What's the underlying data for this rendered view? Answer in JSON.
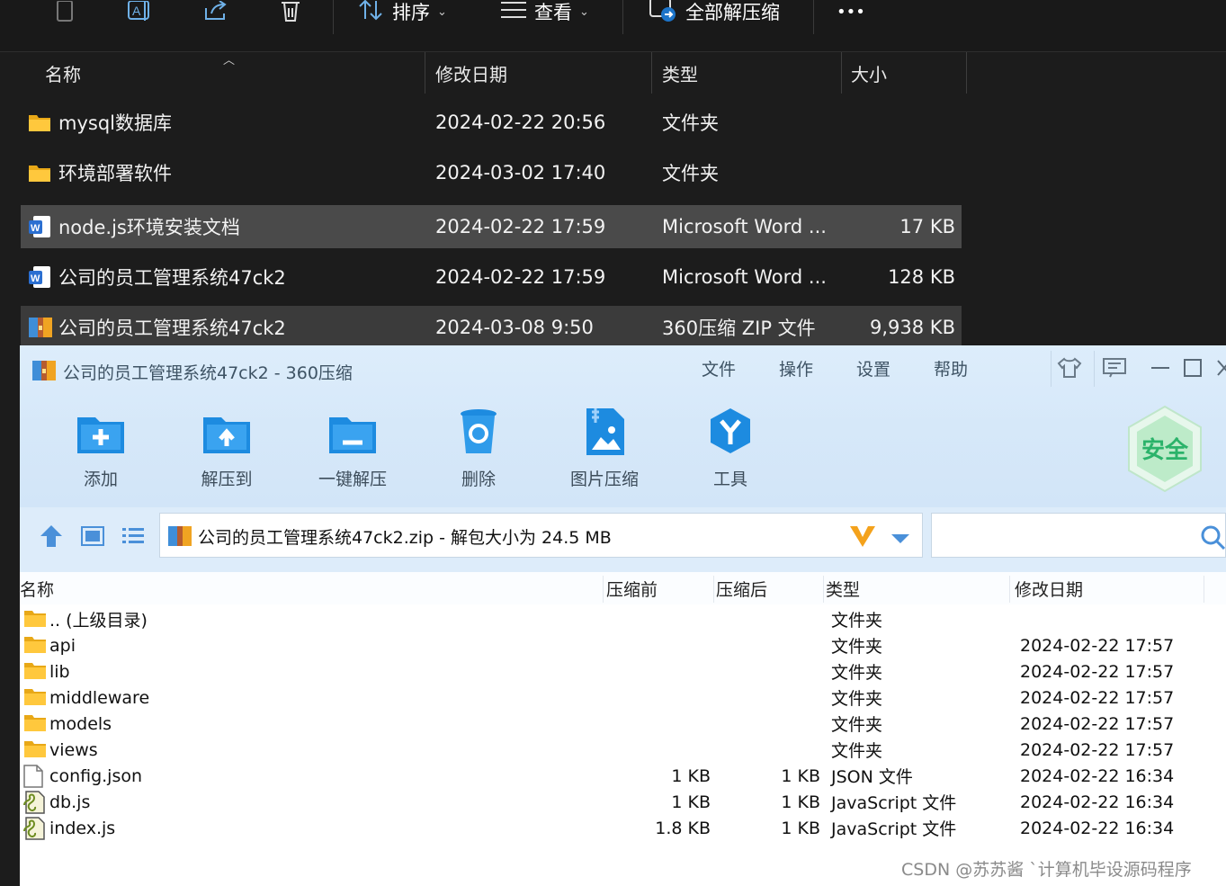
{
  "explorer": {
    "toolbar": {
      "sort_label": "排序",
      "view_label": "查看",
      "extract_all_label": "全部解压缩",
      "more_label": "•••"
    },
    "columns": {
      "name": "名称",
      "modified": "修改日期",
      "type": "类型",
      "size": "大小"
    },
    "rows": [
      {
        "name": "mysql数据库",
        "modified": "2024-02-22 20:56",
        "type": "文件夹",
        "size": "",
        "icon": "folder-icon"
      },
      {
        "name": "环境部署软件",
        "modified": "2024-03-02 17:40",
        "type": "文件夹",
        "size": "",
        "icon": "folder-icon"
      },
      {
        "name": "node.js环境安装文档",
        "modified": "2024-02-22 17:59",
        "type": "Microsoft Word ...",
        "size": "17 KB",
        "icon": "word-doc-icon"
      },
      {
        "name": "公司的员工管理系统47ck2",
        "modified": "2024-02-22 17:59",
        "type": "Microsoft Word ...",
        "size": "128 KB",
        "icon": "word-doc-icon"
      },
      {
        "name": "公司的员工管理系统47ck2",
        "modified": "2024-03-08 9:50",
        "type": "360压缩 ZIP 文件",
        "size": "9,938 KB",
        "icon": "zip-archive-icon"
      }
    ]
  },
  "zip": {
    "title": "公司的员工管理系统47ck2 - 360压缩",
    "menu": [
      "文件",
      "操作",
      "设置",
      "帮助"
    ],
    "tools": [
      "添加",
      "解压到",
      "一键解压",
      "删除",
      "图片压缩",
      "工具"
    ],
    "safe_badge": "安全",
    "address": "公司的员工管理系统47ck2.zip - 解包大小为 24.5 MB",
    "search_placeholder": "",
    "columns": {
      "name": "名称",
      "before": "压缩前",
      "after": "压缩后",
      "type": "类型",
      "modified": "修改日期"
    },
    "rows": [
      {
        "name": ".. (上级目录)",
        "before": "",
        "after": "",
        "type": "文件夹",
        "modified": "",
        "icon": "folder-icon"
      },
      {
        "name": "api",
        "before": "",
        "after": "",
        "type": "文件夹",
        "modified": "2024-02-22 17:57",
        "icon": "folder-icon"
      },
      {
        "name": "lib",
        "before": "",
        "after": "",
        "type": "文件夹",
        "modified": "2024-02-22 17:57",
        "icon": "folder-icon"
      },
      {
        "name": "middleware",
        "before": "",
        "after": "",
        "type": "文件夹",
        "modified": "2024-02-22 17:57",
        "icon": "folder-icon"
      },
      {
        "name": "models",
        "before": "",
        "after": "",
        "type": "文件夹",
        "modified": "2024-02-22 17:57",
        "icon": "folder-icon"
      },
      {
        "name": "views",
        "before": "",
        "after": "",
        "type": "文件夹",
        "modified": "2024-02-22 17:57",
        "icon": "folder-icon"
      },
      {
        "name": "config.json",
        "before": "1 KB",
        "after": "1 KB",
        "type": "JSON 文件",
        "modified": "2024-02-22 16:34",
        "icon": "file-icon"
      },
      {
        "name": "db.js",
        "before": "1 KB",
        "after": "1 KB",
        "type": "JavaScript 文件",
        "modified": "2024-02-22 16:34",
        "icon": "script-file-icon"
      },
      {
        "name": "index.js",
        "before": "1.8 KB",
        "after": "1 KB",
        "type": "JavaScript 文件",
        "modified": "2024-02-22 16:34",
        "icon": "script-file-icon"
      }
    ]
  },
  "watermark": "CSDN @苏苏酱 `计算机毕设源码程序"
}
